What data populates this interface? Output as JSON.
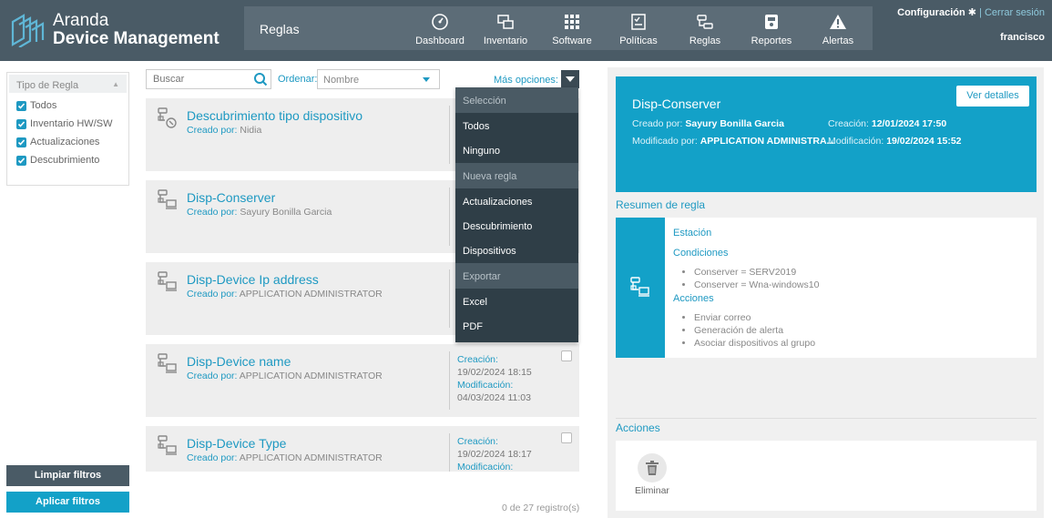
{
  "brand": {
    "line1": "Aranda",
    "line2": "Device Management"
  },
  "navbar": {
    "section_title": "Reglas",
    "items": [
      {
        "label": "Dashboard",
        "icon": "dashboard-icon"
      },
      {
        "label": "Inventario",
        "icon": "inventory-icon"
      },
      {
        "label": "Software",
        "icon": "software-grid-icon"
      },
      {
        "label": "Políticas",
        "icon": "policies-icon"
      },
      {
        "label": "Reglas",
        "icon": "rules-icon"
      },
      {
        "label": "Reportes",
        "icon": "reports-icon"
      },
      {
        "label": "Alertas",
        "icon": "alert-icon"
      }
    ]
  },
  "topbar": {
    "config_label": "Configuración",
    "separator": "|",
    "logout_label": "Cerrar sesión",
    "username": "francisco"
  },
  "filters": {
    "title": "Tipo de Regla",
    "items": [
      {
        "label": "Todos",
        "checked": true
      },
      {
        "label": "Inventario HW/SW",
        "checked": true
      },
      {
        "label": "Actualizaciones",
        "checked": true
      },
      {
        "label": "Descubrimiento",
        "checked": true
      }
    ],
    "clear_label": "Limpiar filtros",
    "apply_label": "Aplicar filtros"
  },
  "search": {
    "placeholder": "Buscar",
    "value": ""
  },
  "order": {
    "label": "Ordenar:",
    "selected": "Nombre"
  },
  "more_options": {
    "label": "Más opciones:"
  },
  "dropdown": {
    "sections": [
      {
        "header": "Selección",
        "items": [
          "Todos",
          "Ninguno"
        ]
      },
      {
        "header": "Nueva regla",
        "items": [
          "Actualizaciones",
          "Descubrimiento",
          "Dispositivos"
        ]
      },
      {
        "header": "Exportar",
        "items": [
          "Excel",
          "PDF"
        ]
      }
    ]
  },
  "rules": {
    "created_by_label": "Creado por:",
    "created_label": "Creación:",
    "modified_label": "Modificación:",
    "items": [
      {
        "title": "Descubrimiento tipo dispositivo",
        "author": "Nidia",
        "created": "",
        "modified": ""
      },
      {
        "title": "Disp-Conserver",
        "author": "Sayury Bonilla Garcia",
        "created": "",
        "modified": ""
      },
      {
        "title": "Disp-Device Ip address",
        "author": "APPLICATION ADMINISTRATOR",
        "created": "",
        "modified": ""
      },
      {
        "title": "Disp-Device name",
        "author": "APPLICATION ADMINISTRATOR",
        "created": "19/02/2024 18:15",
        "modified": "04/03/2024 11:03"
      },
      {
        "title": "Disp-Device Type",
        "author": "APPLICATION ADMINISTRATOR",
        "created": "19/02/2024 18:17",
        "modified": ""
      }
    ],
    "records_text": "0 de 27 registro(s)"
  },
  "detail": {
    "title": "Disp-Conserver",
    "view_button": "Ver detalles",
    "created_by_label": "Creado por:",
    "created_by": "Sayury Bonilla Garcia",
    "modified_by_label": "Modificado por:",
    "modified_by": "APPLICATION ADMINISTRA...",
    "created_label": "Creación:",
    "created": "12/01/2024 17:50",
    "modified_label": "Modificación:",
    "modified": "19/02/2024 15:52"
  },
  "summary": {
    "title": "Resumen de regla",
    "station_label": "Estación",
    "conditions_label": "Condiciones",
    "conditions": [
      "Conserver = SERV2019",
      "Conserver = Wna-windows10"
    ],
    "actions_label": "Acciones",
    "actions": [
      "Enviar correo",
      "Generación de alerta",
      "Asociar dispositivos al grupo"
    ]
  },
  "actions_panel": {
    "title": "Acciones",
    "delete_label": "Eliminar"
  },
  "colors": {
    "header": "#4a5b66",
    "accent": "#13a1c8",
    "link": "#1e99c2",
    "dropdown": "#2f3e47"
  }
}
